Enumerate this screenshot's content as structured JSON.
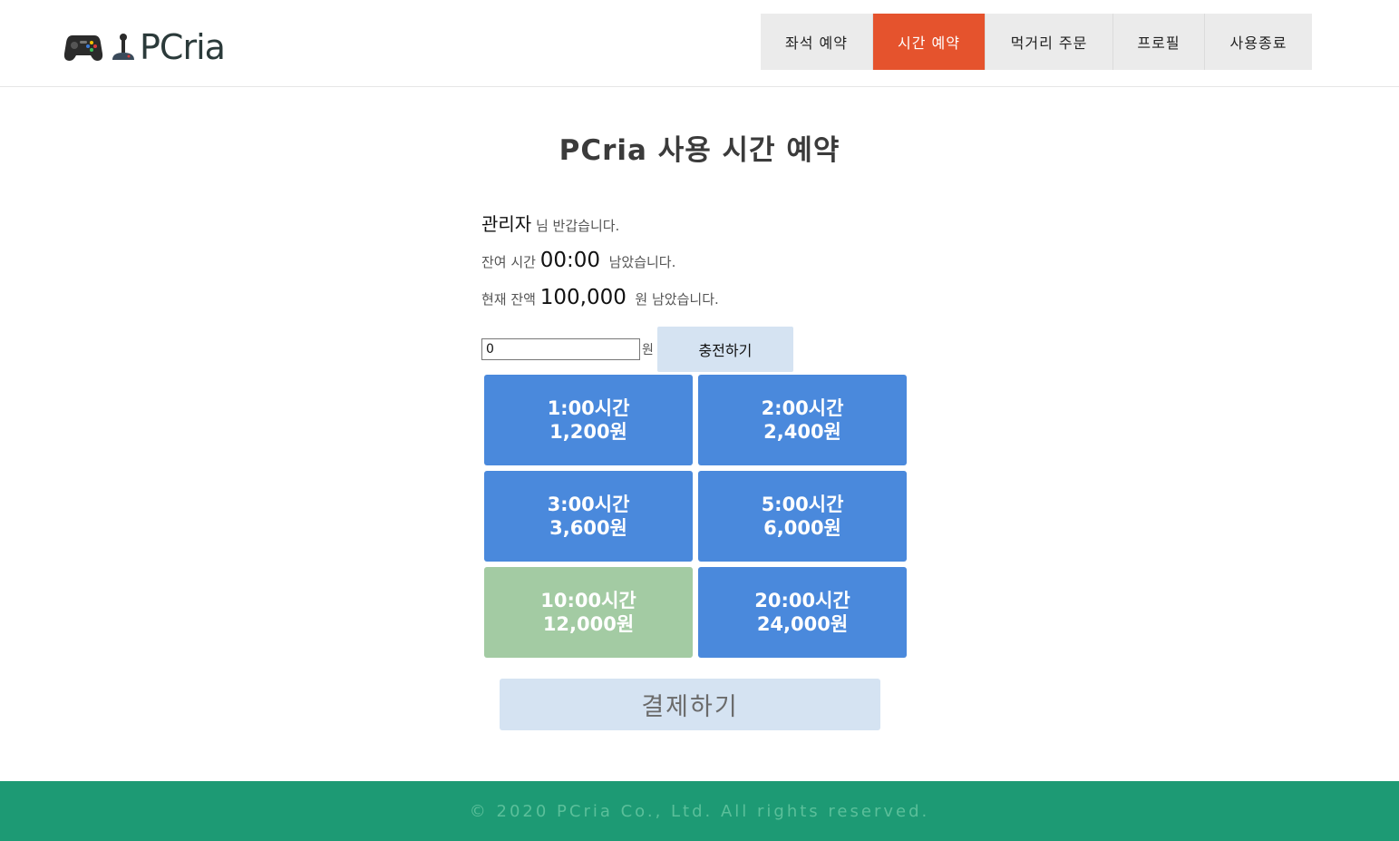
{
  "header": {
    "brand": "PCria",
    "nav": [
      {
        "label": "좌석 예약",
        "active": false
      },
      {
        "label": "시간 예약",
        "active": true
      },
      {
        "label": "먹거리 주문",
        "active": false
      },
      {
        "label": "프로필",
        "active": false
      },
      {
        "label": "사용종료",
        "active": false
      }
    ]
  },
  "main": {
    "title": "PCria 사용 시간 예약",
    "user_name": "관리자",
    "greeting_suffix": "님 반갑습니다.",
    "remaining_time_label": "잔여 시간",
    "remaining_time": "00:00",
    "remaining_time_suffix": "남았습니다.",
    "balance_label": "현재 잔액",
    "balance": "100,000",
    "balance_suffix": "원 남았습니다.",
    "charge_input_value": "0",
    "charge_unit": "원",
    "charge_button": "충전하기",
    "options": [
      {
        "time": "1:00시간",
        "price": "1,200원",
        "selected": false
      },
      {
        "time": "2:00시간",
        "price": "2,400원",
        "selected": false
      },
      {
        "time": "3:00시간",
        "price": "3,600원",
        "selected": false
      },
      {
        "time": "5:00시간",
        "price": "6,000원",
        "selected": false
      },
      {
        "time": "10:00시간",
        "price": "12,000원",
        "selected": true
      },
      {
        "time": "20:00시간",
        "price": "24,000원",
        "selected": false
      }
    ],
    "pay_button": "결제하기"
  },
  "footer": {
    "copyright": "© 2020 PCria Co., Ltd. All rights reserved."
  },
  "colors": {
    "accent": "#e5532d",
    "option": "#4a89dc",
    "option_selected": "#a3cba3",
    "footer": "#1d9a74"
  }
}
